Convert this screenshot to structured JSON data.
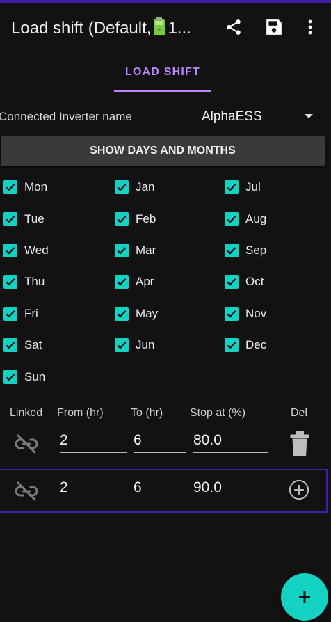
{
  "app": {
    "title_prefix": "Load shift (Default,",
    "title_suffix": "1...",
    "icons": [
      "share-icon",
      "save-icon",
      "more-vert-icon",
      "battery-icon"
    ]
  },
  "tabs": [
    {
      "label": "LOAD SHIFT",
      "selected": true
    }
  ],
  "inverter": {
    "label": "Connected Inverter name",
    "value": "AlphaESS"
  },
  "show_button": {
    "label": "SHOW DAYS AND MONTHS"
  },
  "days": [
    {
      "label": "Mon",
      "checked": true
    },
    {
      "label": "Tue",
      "checked": true
    },
    {
      "label": "Wed",
      "checked": true
    },
    {
      "label": "Thu",
      "checked": true
    },
    {
      "label": "Fri",
      "checked": true
    },
    {
      "label": "Sat",
      "checked": true
    },
    {
      "label": "Sun",
      "checked": true
    }
  ],
  "months_col1": [
    {
      "label": "Jan",
      "checked": true
    },
    {
      "label": "Feb",
      "checked": true
    },
    {
      "label": "Mar",
      "checked": true
    },
    {
      "label": "Apr",
      "checked": true
    },
    {
      "label": "May",
      "checked": true
    },
    {
      "label": "Jun",
      "checked": true
    }
  ],
  "months_col2": [
    {
      "label": "Jul",
      "checked": true
    },
    {
      "label": "Aug",
      "checked": true
    },
    {
      "label": "Sep",
      "checked": true
    },
    {
      "label": "Oct",
      "checked": true
    },
    {
      "label": "Nov",
      "checked": true
    },
    {
      "label": "Dec",
      "checked": true
    }
  ],
  "table": {
    "headers": {
      "linked": "Linked",
      "from": "From (hr)",
      "to": "To (hr)",
      "stop": "Stop at (%)",
      "del": "Del"
    },
    "rows": [
      {
        "from": "2",
        "to": "6",
        "stop": "80.0",
        "action": "delete"
      },
      {
        "from": "2",
        "to": "6",
        "stop": "90.0",
        "action": "add"
      }
    ]
  },
  "fab": {
    "icon": "plus-icon"
  },
  "colors": {
    "accent": "#bb86fc",
    "checkbox": "#13d2c1",
    "highlight": "#3f1ea8",
    "background": "#121212"
  }
}
